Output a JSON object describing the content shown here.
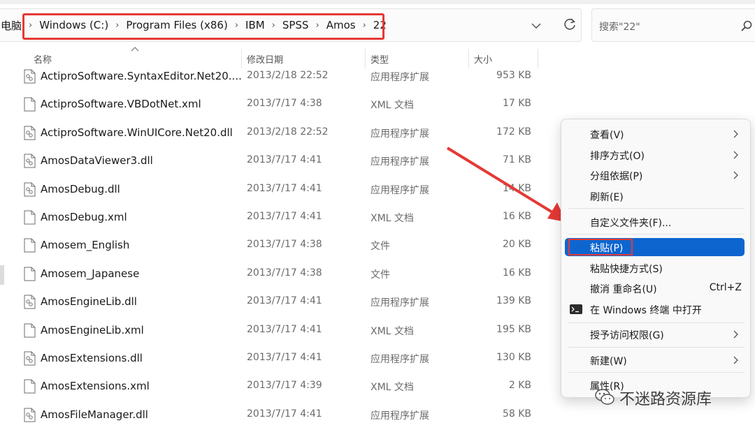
{
  "address_bar": {
    "prefix": "电脑",
    "crumbs": [
      "Windows (C:)",
      "Program Files (x86)",
      "IBM",
      "SPSS",
      "Amos",
      "22"
    ]
  },
  "search": {
    "placeholder": "搜索\"22\""
  },
  "columns": {
    "name": "名称",
    "date": "修改日期",
    "type": "类型",
    "size": "大小"
  },
  "files": [
    {
      "name": "ActiproSoftware.SyntaxEditor.Net20....",
      "date": "2013/2/18 22:52",
      "type": "应用程序扩展",
      "size": "953 KB",
      "icon": "dll-file-icon"
    },
    {
      "name": "ActiproSoftware.VBDotNet.xml",
      "date": "2013/7/17 4:38",
      "type": "XML 文档",
      "size": "17 KB",
      "icon": "file-icon"
    },
    {
      "name": "ActiproSoftware.WinUICore.Net20.dll",
      "date": "2013/2/18 22:52",
      "type": "应用程序扩展",
      "size": "172 KB",
      "icon": "dll-file-icon"
    },
    {
      "name": "AmosDataViewer3.dll",
      "date": "2013/7/17 4:41",
      "type": "应用程序扩展",
      "size": "71 KB",
      "icon": "dll-file-icon"
    },
    {
      "name": "AmosDebug.dll",
      "date": "2013/7/17 4:41",
      "type": "应用程序扩展",
      "size": "14 KB",
      "icon": "dll-file-icon"
    },
    {
      "name": "AmosDebug.xml",
      "date": "2013/7/17 4:41",
      "type": "XML 文档",
      "size": "16 KB",
      "icon": "file-icon"
    },
    {
      "name": "Amosem_English",
      "date": "2013/7/17 4:38",
      "type": "文件",
      "size": "20 KB",
      "icon": "file-icon"
    },
    {
      "name": "Amosem_Japanese",
      "date": "2013/7/17 4:38",
      "type": "文件",
      "size": "16 KB",
      "icon": "file-icon"
    },
    {
      "name": "AmosEngineLib.dll",
      "date": "2013/7/17 4:41",
      "type": "应用程序扩展",
      "size": "139 KB",
      "icon": "dll-file-icon"
    },
    {
      "name": "AmosEngineLib.xml",
      "date": "2013/7/17 4:41",
      "type": "XML 文档",
      "size": "195 KB",
      "icon": "file-icon"
    },
    {
      "name": "AmosExtensions.dll",
      "date": "2013/7/17 4:41",
      "type": "应用程序扩展",
      "size": "130 KB",
      "icon": "dll-file-icon"
    },
    {
      "name": "AmosExtensions.xml",
      "date": "2013/7/17 4:39",
      "type": "XML 文档",
      "size": "2 KB",
      "icon": "file-icon"
    },
    {
      "name": "AmosFileManager.dll",
      "date": "2013/7/17 4:41",
      "type": "应用程序扩展",
      "size": "58 KB",
      "icon": "dll-file-icon"
    }
  ],
  "context_menu": {
    "view": "查看(V)",
    "sort": "排序方式(O)",
    "group": "分组依据(P)",
    "refresh": "刷新(E)",
    "customize": "自定义文件夹(F)...",
    "paste": "粘贴(P)",
    "paste_shortcut": "粘贴快捷方式(S)",
    "undo": "撤消 重命名(U)",
    "undo_shortcut": "Ctrl+Z",
    "terminal": "在 Windows 终端 中打开",
    "access": "授予访问权限(G)",
    "new": "新建(W)",
    "properties": "属性(R)"
  },
  "watermark": "不迷路资源库",
  "colors": {
    "highlight_red": "#e53935",
    "menu_selected": "#0d66d0"
  }
}
